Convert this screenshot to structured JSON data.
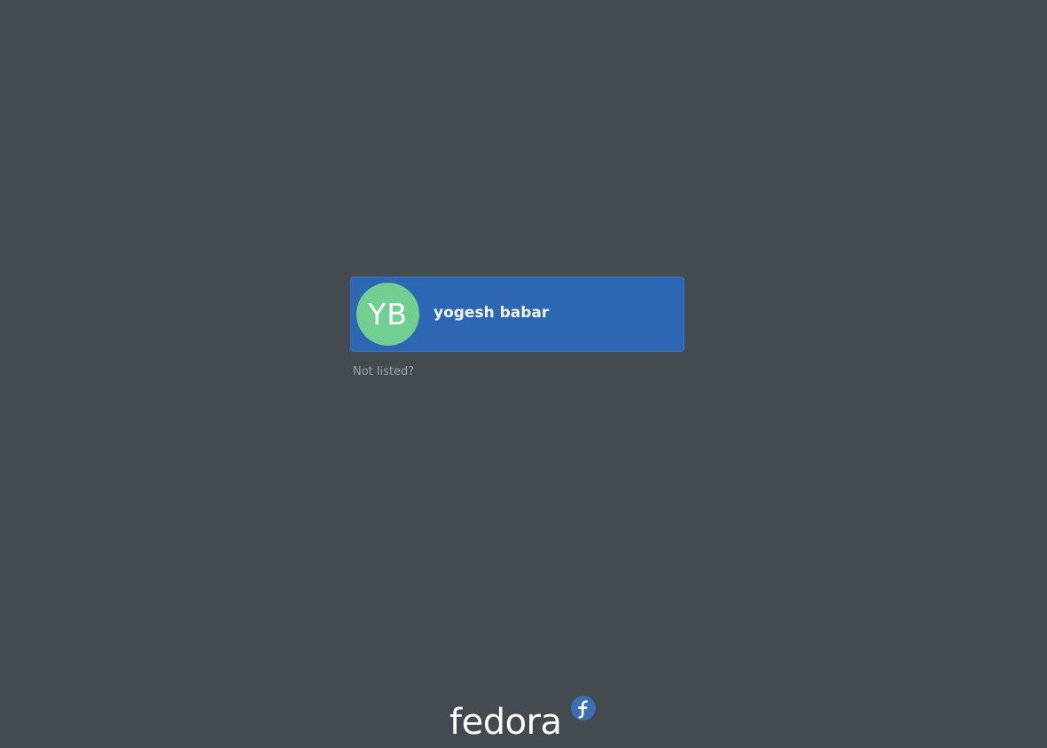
{
  "users": [
    {
      "initials": "YB",
      "name": "yogesh babar",
      "avatar_color": "#71d091"
    }
  ],
  "not_listed_label": "Not listed?",
  "brand": {
    "wordmark": "fedora",
    "logo_icon": "fedora-infinity-icon"
  },
  "colors": {
    "background": "#434b50",
    "selection": "#2d66b3",
    "logo_accent": "#3c6eb4"
  }
}
